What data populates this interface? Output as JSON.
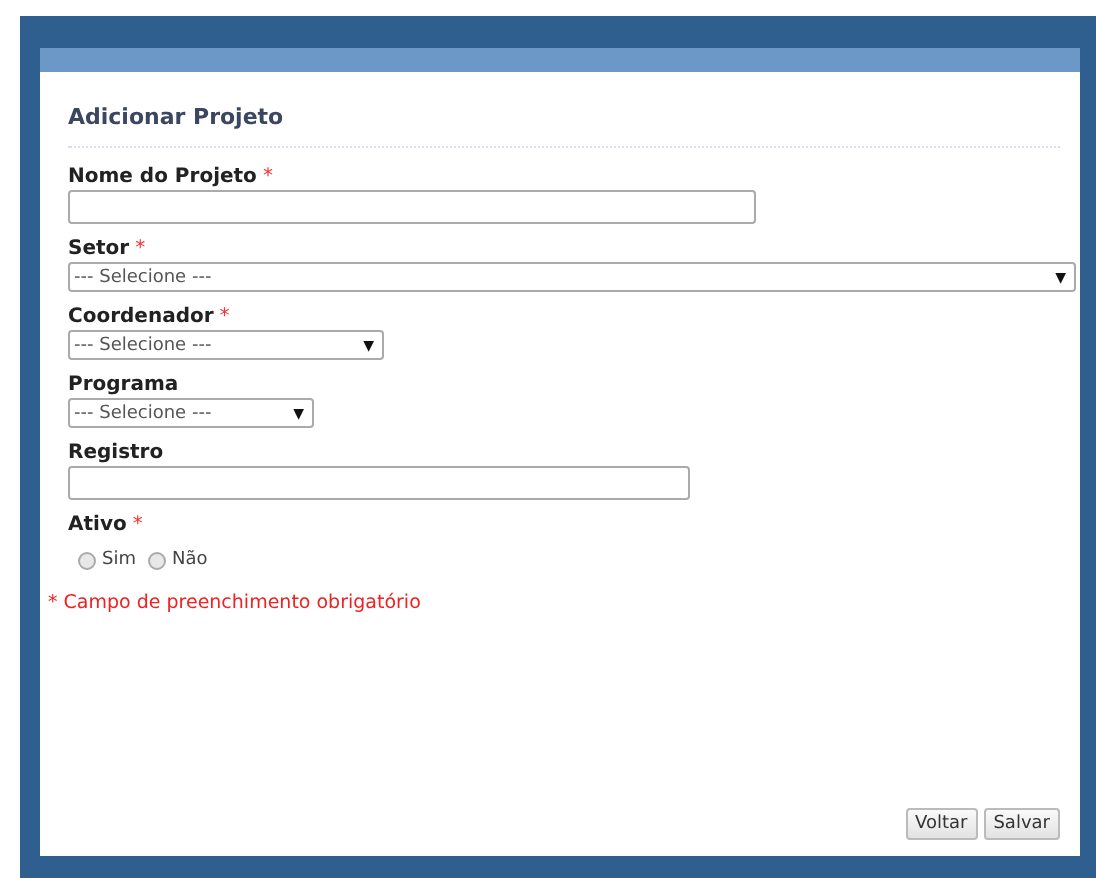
{
  "form": {
    "title": "Adicionar Projeto",
    "fields": [
      {
        "kind": "text",
        "label": "Nome do Projeto",
        "required_mark": "*"
      },
      {
        "kind": "select",
        "label": "Setor",
        "required_mark": "*",
        "value": "--- Selecione ---",
        "arrow": "▼"
      },
      {
        "kind": "select",
        "label": "Coordenador",
        "required_mark": "*",
        "value": "--- Selecione ---",
        "arrow": "▼"
      },
      {
        "kind": "select",
        "label": "Programa",
        "value": "--- Selecione ---",
        "arrow": "▼"
      },
      {
        "kind": "text",
        "label": "Registro"
      },
      {
        "kind": "radio",
        "label": "Ativo",
        "required_mark": "*",
        "options": [
          {
            "label": "Sim",
            "selected": false
          },
          {
            "label": "Não",
            "selected": false
          }
        ]
      }
    ],
    "required_note": {
      "mark": "*",
      "text": "Campo de preenchimento obrigatório"
    },
    "buttons": [
      "Voltar",
      "Salvar"
    ]
  }
}
